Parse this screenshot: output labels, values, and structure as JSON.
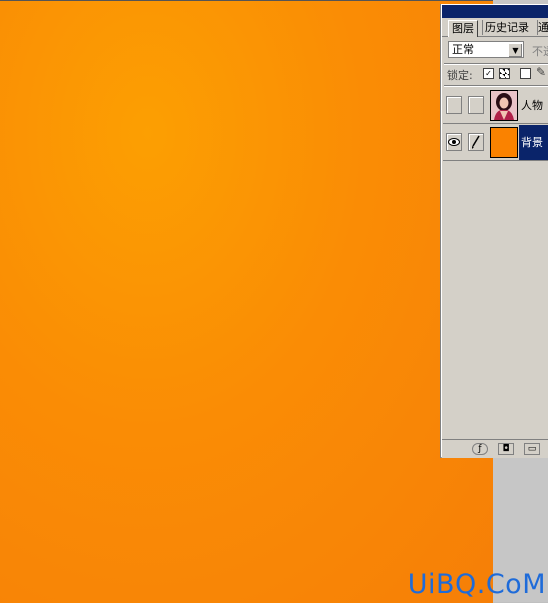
{
  "panel": {
    "tabs": [
      {
        "label": "图层",
        "active": true
      },
      {
        "label": "历史记录",
        "active": false
      },
      {
        "label": "通",
        "active": false
      }
    ],
    "blend_mode": "正常",
    "opacity_label": "不透",
    "lock_label": "锁定:",
    "layers": [
      {
        "name": "人物",
        "thumbnail": "portrait-photo",
        "visible": false,
        "selected": false
      },
      {
        "name": "背景",
        "thumbnail": "orange-fill",
        "visible": true,
        "selected": true
      }
    ],
    "bottom_icons": [
      "layer-style-icon",
      "mask-icon",
      "new-folder-icon"
    ]
  },
  "canvas": {
    "fill_color": "#fa8c05"
  },
  "watermark": "UiBQ.CoM",
  "colors": {
    "title_bar": "#0a246a",
    "selection": "#0a246a",
    "panel_bg": "#d4d0c8",
    "watermark": "#1e6bd9"
  }
}
